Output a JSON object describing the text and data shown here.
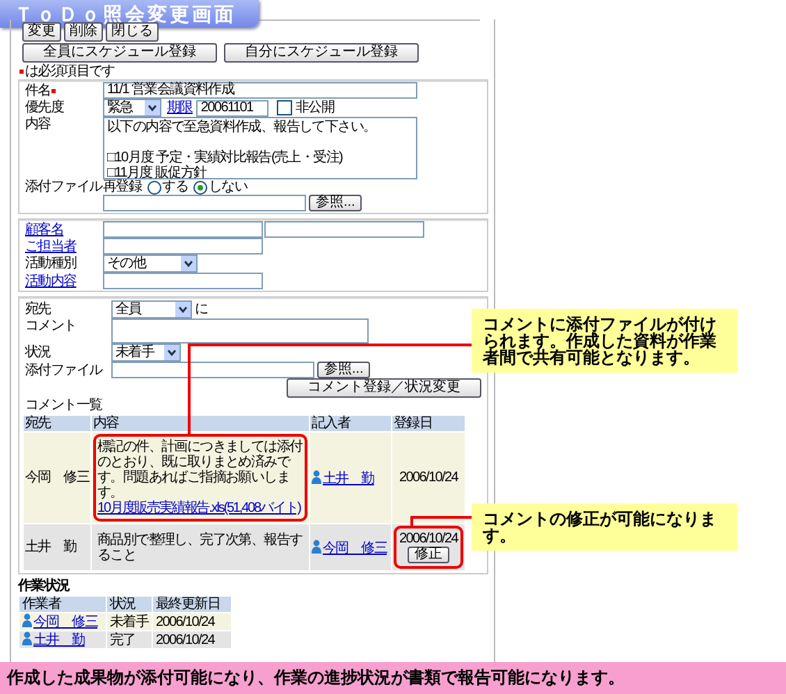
{
  "title": "ＴｏＤｏ照会変更画面",
  "top_buttons": [
    "変更",
    "削除",
    "閉じる"
  ],
  "schedule_buttons": [
    "全員にスケジュール登録",
    "自分にスケジュール登録"
  ],
  "required_note": "は必須項目です",
  "task_form": {
    "subject": {
      "label": "件名",
      "required": true,
      "value": "11/1 営業会議資料作成"
    },
    "priority": {
      "label": "優先度",
      "value": "緊急"
    },
    "due": {
      "label": "期限",
      "value": "20061101"
    },
    "private": {
      "label": "非公開",
      "checked": false
    },
    "content": {
      "label": "内容",
      "value": "以下の内容で至急資料作成、報告して下さい。\n\n□10月度 予定・実績対比報告(売上・受注)\n□11月度 販促方針"
    },
    "attachment": {
      "label": "添付ファイル",
      "reregister_label": "再登録",
      "options": [
        {
          "label": "する",
          "selected": false
        },
        {
          "label": "しない",
          "selected": true
        }
      ],
      "browse_button": "参照..."
    }
  },
  "customer_form": [
    {
      "label": "顧客名",
      "kind": "double"
    },
    {
      "label": "ご担当者",
      "kind": "link"
    },
    {
      "label": "活動種別",
      "kind": "select",
      "value": "その他"
    },
    {
      "label": "活動内容",
      "kind": "link"
    }
  ],
  "comment_form": {
    "to_label": "宛先",
    "to_value": "全員",
    "to_suffix": "に",
    "comment_label": "コメント",
    "status_label": "状況",
    "status_value": "未着手",
    "attachment_label": "添付ファイル",
    "browse_button": "参照...",
    "submit_button": "コメント登録／状況変更"
  },
  "comment_list": {
    "title": "コメント一覧",
    "columns": [
      "宛先",
      "内容",
      "記入者",
      "登録日"
    ],
    "rows": [
      {
        "to": "今岡　修三",
        "content": "標記の件、計画につきましては添付のとおり、既に取りまとめ済みです。問題あればご指摘お願いします。",
        "attachment": "10月度販売実績報告.xls(51,408バイト)",
        "author": "土井　勤",
        "date": "2006/10/24"
      },
      {
        "to": "土井　勤",
        "content": "商品別で整理し、完了次第、報告すること",
        "author": "今岡　修三",
        "date": "2006/10/24",
        "edit_button": "修正"
      }
    ]
  },
  "work_status": {
    "title": "作業状況",
    "columns": [
      "作業者",
      "状況",
      "最終更新日"
    ],
    "rows": [
      {
        "worker": "今岡　修三",
        "status": "未着手",
        "date": "2006/10/24"
      },
      {
        "worker": "土井　勤",
        "status": "完了",
        "date": "2006/10/24"
      }
    ]
  },
  "callouts": [
    "コメントに添付ファイルが付けられます。作成した資料が作業者間で共有可能となります。",
    "コメントの修正が可能になります。"
  ],
  "banner": "作成した成果物が添付可能になり、作業の進捗状況が書類で報告可能になります。"
}
